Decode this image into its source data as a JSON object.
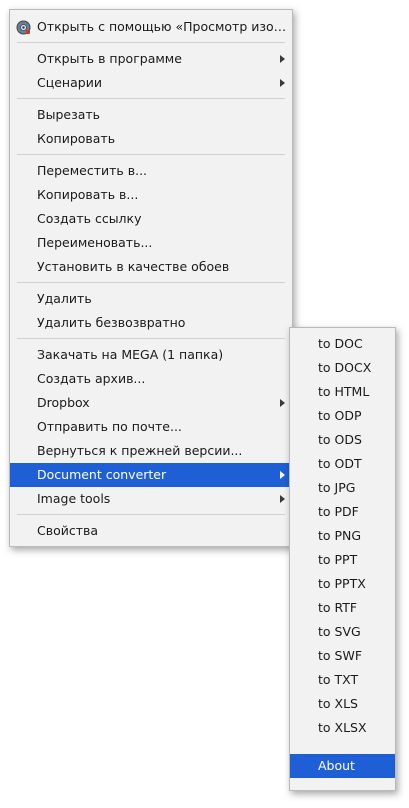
{
  "colors": {
    "menu_background": "#f2f2f2",
    "selected_background": "#1f5fd6",
    "selected_text": "#ffffff",
    "separator": "#d0d0d0"
  },
  "main_menu": {
    "open_with_default": "Открыть с помощью «Просмотр изображе...",
    "open_with_default_icon": "image-viewer-icon",
    "open_in_program": "Открыть в программе",
    "scripts": "Сценарии",
    "cut": "Вырезать",
    "copy": "Копировать",
    "move_to": "Переместить в...",
    "copy_to": "Копировать в...",
    "create_link": "Создать ссылку",
    "rename": "Переименовать...",
    "set_as_wallpaper": "Установить в качестве обоев",
    "delete": "Удалить",
    "delete_permanently": "Удалить безвозвратно",
    "upload_to_mega": "Закачать на MEGA (1 папка)",
    "create_archive": "Создать архив...",
    "dropbox": "Dropbox",
    "send_by_email": "Отправить по почте...",
    "revert_to_previous": "Вернуться к прежней версии...",
    "document_converter": "Document converter",
    "image_tools": "Image tools",
    "properties": "Свойства"
  },
  "submenu": {
    "items": [
      "to DOC",
      "to DOCX",
      "to HTML",
      "to ODP",
      "to ODS",
      "to ODT",
      "to JPG",
      "to PDF",
      "to PNG",
      "to PPT",
      "to PPTX",
      "to RTF",
      "to SVG",
      "to SWF",
      "to TXT",
      "to XLS",
      "to XLSX"
    ],
    "about": "About"
  }
}
